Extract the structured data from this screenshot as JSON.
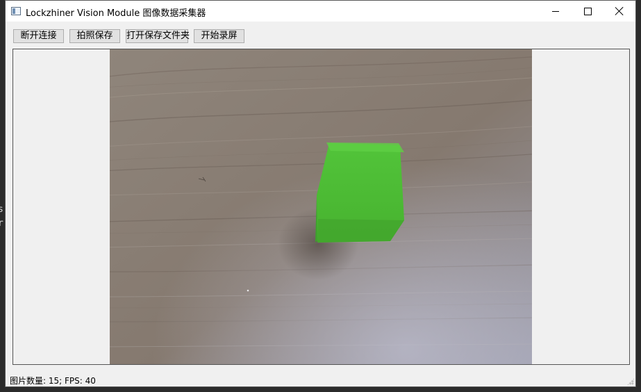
{
  "window": {
    "title": "Lockzhiner Vision Module 图像数据采集器",
    "controls": [
      "minimize",
      "maximize",
      "close"
    ]
  },
  "toolbar": {
    "disconnect_label": "断开连接",
    "capture_label": "拍照保存",
    "open_folder_label": "打开保存文件夹",
    "record_label": "开始录屏"
  },
  "preview": {
    "content": "camera feed: green cube on wooden table"
  },
  "status": {
    "text": "图片数量: 15; FPS: 40"
  },
  "background": {
    "partial_text_1": "s",
    "partial_text_2": "r"
  },
  "colors": {
    "window_bg": "#f0f0f0",
    "titlebar_bg": "#ffffff",
    "button_bg": "#e1e1e1",
    "button_border": "#adadad",
    "cube_green": "#4cbd33",
    "wood": "#8a7f76"
  }
}
